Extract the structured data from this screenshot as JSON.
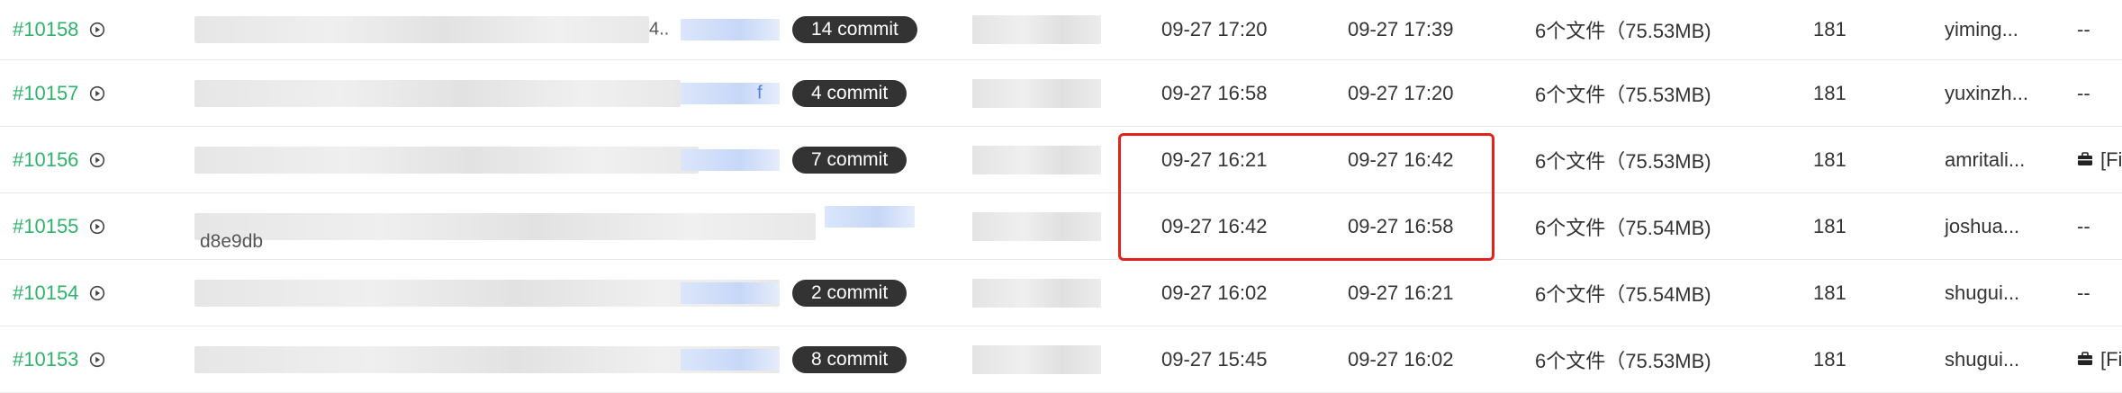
{
  "rows": [
    {
      "id": "#10158",
      "msg_fragment": "4..",
      "msg_fragment_blue": "",
      "msg_second_line": "",
      "commit_badge": "14 commit",
      "start": "09-27 17:20",
      "end": "09-27 17:39",
      "files": "6个文件（75.53MB)",
      "count": "181",
      "user": "yiming...",
      "extra": "--",
      "extra_icon": ""
    },
    {
      "id": "#10157",
      "msg_fragment": "",
      "msg_fragment_blue": "f",
      "msg_second_line": "",
      "commit_badge": "4 commit",
      "start": "09-27 16:58",
      "end": "09-27 17:20",
      "files": "6个文件（75.53MB)",
      "count": "181",
      "user": "yuxinzh...",
      "extra": "--",
      "extra_icon": ""
    },
    {
      "id": "#10156",
      "msg_fragment": "",
      "msg_fragment_blue": "",
      "msg_second_line": "",
      "commit_badge": "7 commit",
      "start": "09-27 16:21",
      "end": "09-27 16:42",
      "files": "6个文件（75.53MB)",
      "count": "181",
      "user": "amritali...",
      "extra": "[Fi",
      "extra_icon": "briefcase-icon"
    },
    {
      "id": "#10155",
      "msg_fragment": "",
      "msg_fragment_blue": "",
      "msg_second_line": "d8e9db",
      "commit_badge": "",
      "start": "09-27 16:42",
      "end": "09-27 16:58",
      "files": "6个文件（75.54MB)",
      "count": "181",
      "user": "joshua...",
      "extra": "--",
      "extra_icon": ""
    },
    {
      "id": "#10154",
      "msg_fragment": "",
      "msg_fragment_blue": "",
      "msg_second_line": "",
      "commit_badge": "2 commit",
      "start": "09-27 16:02",
      "end": "09-27 16:21",
      "files": "6个文件（75.54MB)",
      "count": "181",
      "user": "shugui...",
      "extra": "--",
      "extra_icon": ""
    },
    {
      "id": "#10153",
      "msg_fragment": "",
      "msg_fragment_blue": "",
      "msg_second_line": "",
      "commit_badge": "8 commit",
      "start": "09-27 15:45",
      "end": "09-27 16:02",
      "files": "6个文件（75.53MB)",
      "count": "181",
      "user": "shugui...",
      "extra": "[Fi",
      "extra_icon": "briefcase-icon"
    }
  ],
  "colors": {
    "id_link": "#2fb36b",
    "badge_bg": "#333333",
    "highlight": "#e0241c"
  }
}
